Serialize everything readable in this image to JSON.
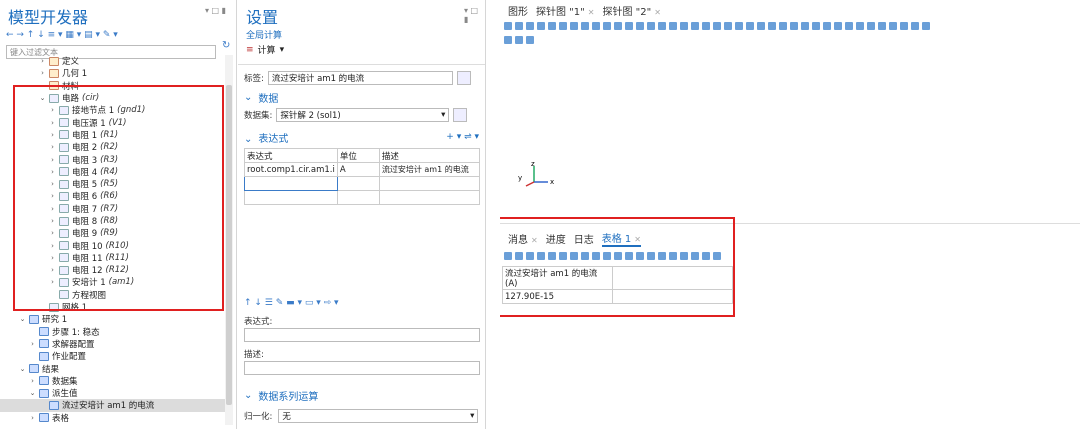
{
  "left": {
    "title": "模型开发器",
    "filter_placeholder": "键入过滤文本",
    "tree": [
      {
        "indent": 3,
        "arrow": "›",
        "label": "定义",
        "tag": ""
      },
      {
        "indent": 3,
        "arrow": "›",
        "label": "几何 1",
        "tag": ""
      },
      {
        "indent": 3,
        "arrow": "",
        "label": "材料",
        "tag": ""
      },
      {
        "indent": 3,
        "arrow": "⌄",
        "label": "电路",
        "tag": "(cir)"
      },
      {
        "indent": 4,
        "arrow": "›",
        "label": "接地节点 1",
        "tag": "(gnd1)"
      },
      {
        "indent": 4,
        "arrow": "›",
        "label": "电压源 1",
        "tag": "(V1)"
      },
      {
        "indent": 4,
        "arrow": "›",
        "label": "电阻 1",
        "tag": "(R1)"
      },
      {
        "indent": 4,
        "arrow": "›",
        "label": "电阻 2",
        "tag": "(R2)"
      },
      {
        "indent": 4,
        "arrow": "›",
        "label": "电阻 3",
        "tag": "(R3)"
      },
      {
        "indent": 4,
        "arrow": "›",
        "label": "电阻 4",
        "tag": "(R4)"
      },
      {
        "indent": 4,
        "arrow": "›",
        "label": "电阻 5",
        "tag": "(R5)"
      },
      {
        "indent": 4,
        "arrow": "›",
        "label": "电阻 6",
        "tag": "(R6)"
      },
      {
        "indent": 4,
        "arrow": "›",
        "label": "电阻 7",
        "tag": "(R7)"
      },
      {
        "indent": 4,
        "arrow": "›",
        "label": "电阻 8",
        "tag": "(R8)"
      },
      {
        "indent": 4,
        "arrow": "›",
        "label": "电阻 9",
        "tag": "(R9)"
      },
      {
        "indent": 4,
        "arrow": "›",
        "label": "电阻 10",
        "tag": "(R10)"
      },
      {
        "indent": 4,
        "arrow": "›",
        "label": "电阻 11",
        "tag": "(R11)"
      },
      {
        "indent": 4,
        "arrow": "›",
        "label": "电阻 12",
        "tag": "(R12)"
      },
      {
        "indent": 4,
        "arrow": "›",
        "label": "安培计 1",
        "tag": "(am1)"
      },
      {
        "indent": 4,
        "arrow": "",
        "label": "方程视图",
        "tag": ""
      },
      {
        "indent": 3,
        "arrow": "",
        "label": "网格 1",
        "tag": ""
      },
      {
        "indent": 1,
        "arrow": "⌄",
        "label": "研究 1",
        "tag": ""
      },
      {
        "indent": 2,
        "arrow": "",
        "label": "步骤 1: 稳态",
        "tag": ""
      },
      {
        "indent": 2,
        "arrow": "›",
        "label": "求解器配置",
        "tag": ""
      },
      {
        "indent": 2,
        "arrow": "",
        "label": "作业配置",
        "tag": ""
      },
      {
        "indent": 1,
        "arrow": "⌄",
        "label": "结果",
        "tag": ""
      },
      {
        "indent": 2,
        "arrow": "›",
        "label": "数据集",
        "tag": ""
      },
      {
        "indent": 2,
        "arrow": "⌄",
        "label": "派生值",
        "tag": ""
      },
      {
        "indent": 3,
        "arrow": "",
        "label": "流过安培计 am1 的电流",
        "tag": "",
        "sel": true
      },
      {
        "indent": 2,
        "arrow": "›",
        "label": "表格",
        "tag": ""
      }
    ]
  },
  "mid": {
    "title": "设置",
    "subtitle": "全局计算",
    "compute": "计算",
    "label_key": "标签:",
    "label_val": "流过安培计 am1 的电流",
    "data_sec": "数据",
    "dataset_key": "数据集:",
    "dataset_val": "探针解 2 (sol1)",
    "expr_sec": "表达式",
    "col_expr": "表达式",
    "col_unit": "单位",
    "col_desc": "描述",
    "row_expr": "root.comp1.cir.am1.i",
    "row_unit": "A",
    "row_desc": "流过安培计 am1 的电流",
    "expr_key": "表达式:",
    "desc_key": "描述:",
    "series_sec": "数据系列运算",
    "norm_key": "归一化:",
    "norm_val": "无"
  },
  "right": {
    "tabs": [
      "图形",
      "探针图 \"1\"",
      "探针图 \"2\""
    ],
    "bottom_tabs": [
      "消息",
      "进度",
      "日志",
      "表格 1"
    ],
    "table_header": "流过安培计 am1 的电流 (A)",
    "table_val": "127.90E-15"
  }
}
